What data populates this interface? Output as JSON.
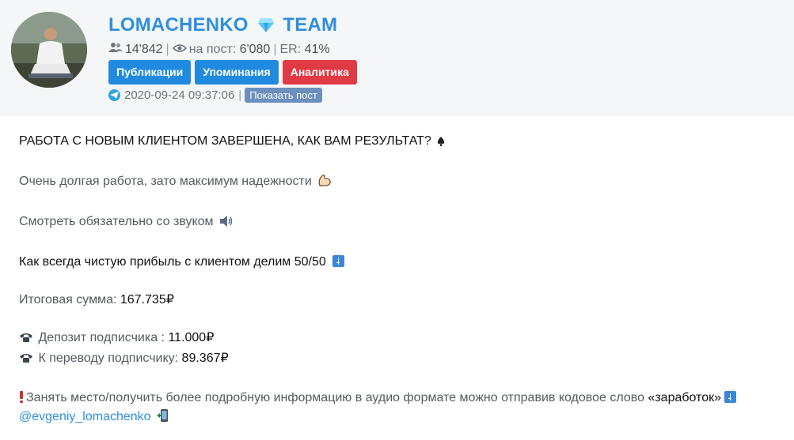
{
  "header": {
    "channel_name": "LOMACHENKO",
    "channel_suffix": "TEAM",
    "icons": {
      "avatar": "channel-avatar-photo",
      "title": "gem-icon",
      "subscribers": "users-icon",
      "views": "eye-icon",
      "date": "telegram-icon"
    },
    "stats": {
      "subscribers": "14'842",
      "views_label": "на пост:",
      "views_value": "6'080",
      "er_label": "ER:",
      "er_value": "41%",
      "separator": "|"
    },
    "buttons": {
      "publications": "Публикации",
      "mentions": "Упоминания",
      "analytics": "Аналитика"
    },
    "date": "2020-09-24 09:37:06",
    "show_post": "Показать пост"
  },
  "post": {
    "line1": "РАБОТА С НОВЫМ КЛИЕНТОМ ЗАВЕРШЕНА, КАК ВАМ РЕЗУЛЬТАТ?",
    "line2": "Очень долгая работа, зато максимум надежности",
    "line3": "Смотреть обязательно со звуком",
    "line4": "Как всегда чистую прибыль с клиентом делим 50/50",
    "total_label": "Итоговая сумма:",
    "total_value": "167.735₽",
    "deposit_label": "Депозит подписчика :",
    "deposit_value": "11.000₽",
    "transfer_label": "К переводу подписчику:",
    "transfer_value": "89.367₽",
    "cta_text": "Занять место/получить более подробную информацию в аудио формате можно отправив кодовое слово",
    "cta_keyword": "«заработок»",
    "contact": "@evgeniy_lomachenko",
    "emojis": [
      "spade-suit",
      "flexed-biceps",
      "speaker-high-volume",
      "arrow-heading-down",
      "telephone-receiver",
      "exclamation-mark",
      "mobile-phone-arrow"
    ]
  },
  "colors": {
    "accent": "#2e8fe0",
    "button_blue": "#1f8ae0",
    "button_red": "#e03a45",
    "header_bg": "#f5f6f7"
  }
}
